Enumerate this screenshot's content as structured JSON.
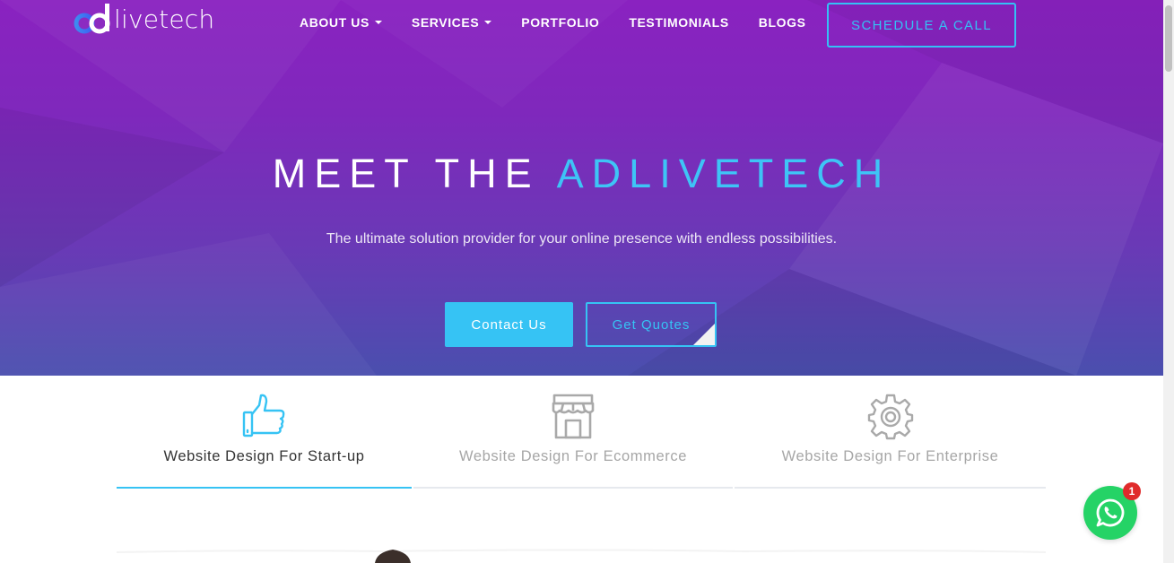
{
  "brand": {
    "logo_text": "livetech",
    "logo_mark": "ad"
  },
  "nav": {
    "items": [
      {
        "label": "ABOUT US",
        "dropdown": true
      },
      {
        "label": "SERVICES",
        "dropdown": true
      },
      {
        "label": "PORTFOLIO",
        "dropdown": false
      },
      {
        "label": "TESTIMONIALS",
        "dropdown": false
      },
      {
        "label": "BLOGS",
        "dropdown": false
      }
    ],
    "cta_label": "SCHEDULE A CALL"
  },
  "hero": {
    "title_main": "MEET THE ",
    "title_accent": "ADLIVETECH",
    "subtitle": "The ultimate solution provider for your online presence with endless possibilities.",
    "contact_button": "Contact Us",
    "quote_button": "Get Quotes"
  },
  "tabs": [
    {
      "label": "Website Design For Start-up",
      "icon": "thumbs-up-icon",
      "active": true
    },
    {
      "label": "Website Design For Ecommerce",
      "icon": "storefront-icon",
      "active": false
    },
    {
      "label": "Website Design For Enterprise",
      "icon": "gear-icon",
      "active": false
    }
  ],
  "whatsapp": {
    "badge_count": "1",
    "icon": "whatsapp-icon"
  },
  "colors": {
    "accent": "#36c3f4",
    "hero_top": "#8a22c0",
    "hero_bottom": "#4a4fae",
    "inactive_text": "#a6a6a6",
    "whatsapp": "#25d366",
    "badge": "#e02b2b"
  }
}
